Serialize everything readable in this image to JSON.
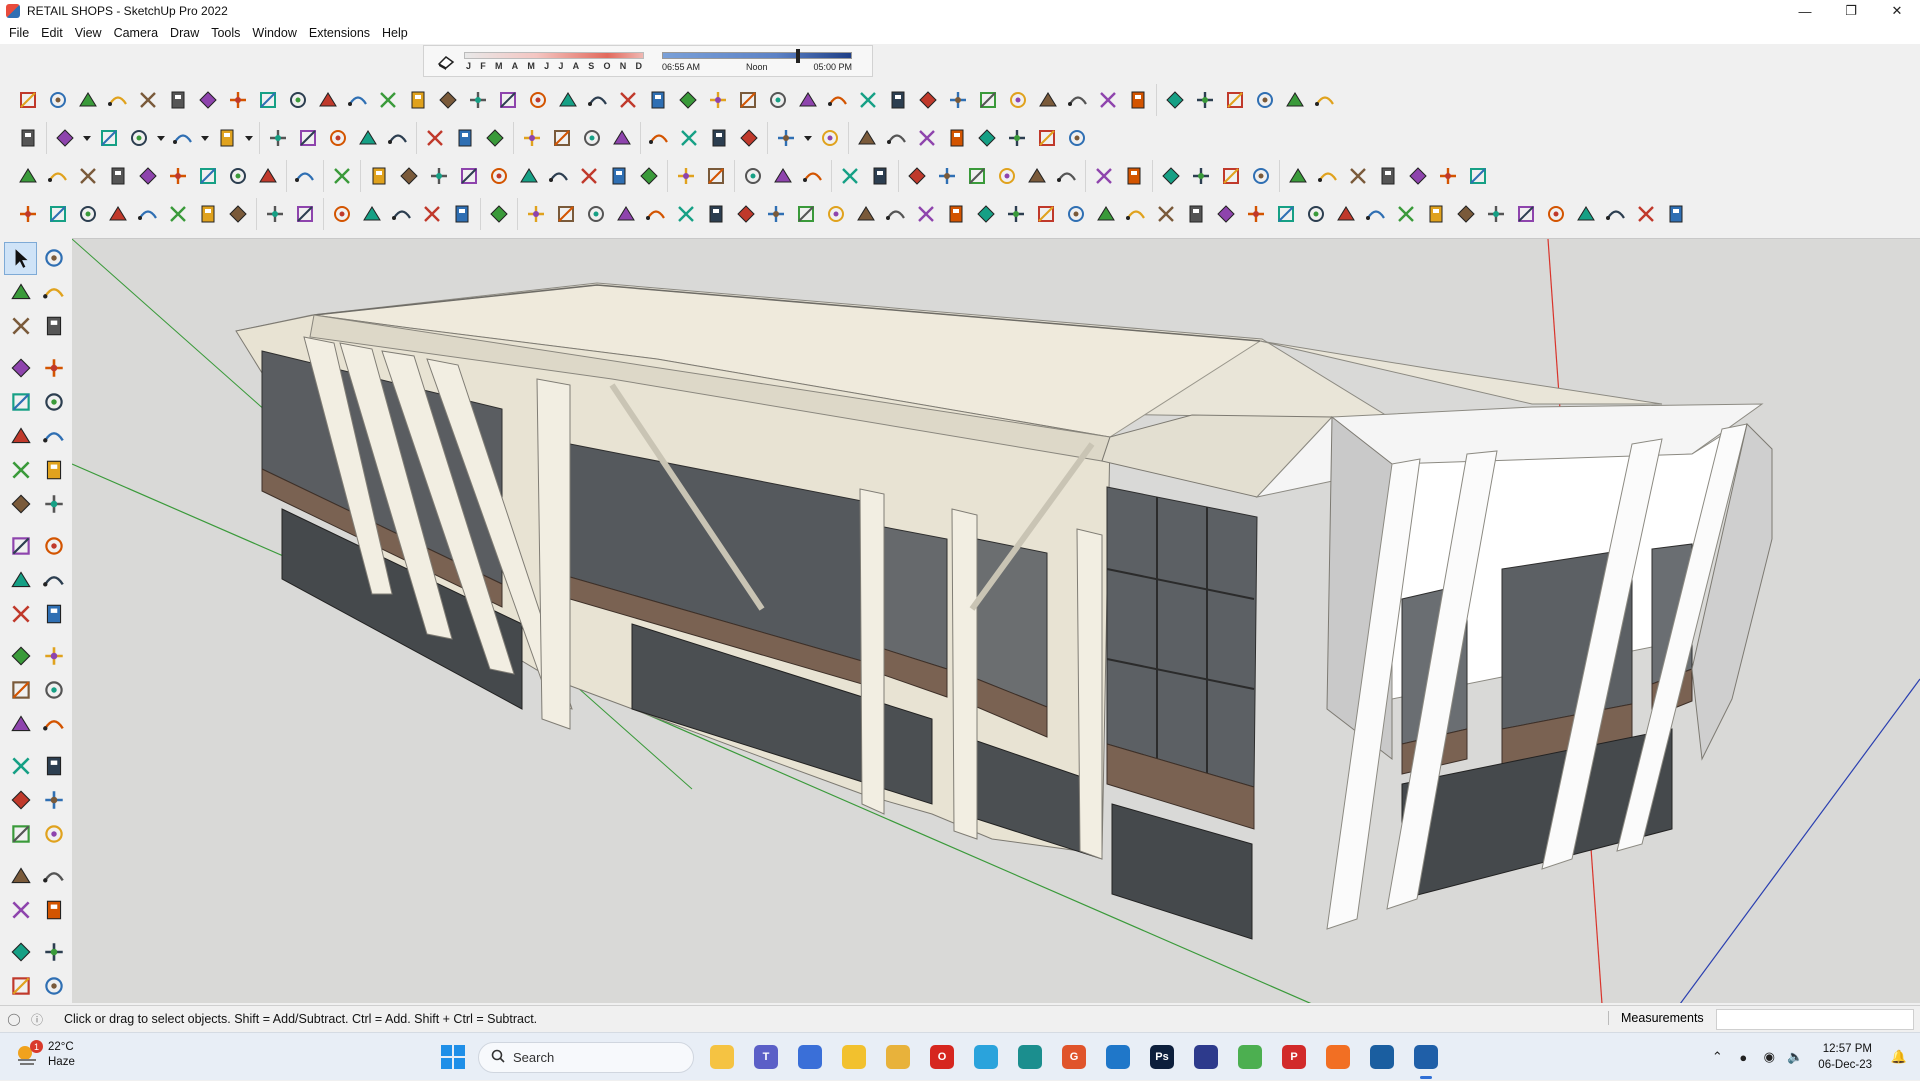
{
  "window": {
    "title": "RETAIL SHOPS - SketchUp Pro 2022",
    "controls": [
      "minimize",
      "maximize",
      "close"
    ]
  },
  "menubar": {
    "items": [
      "File",
      "Edit",
      "View",
      "Camera",
      "Draw",
      "Tools",
      "Window",
      "Extensions",
      "Help"
    ]
  },
  "shadows": {
    "months": [
      "J",
      "F",
      "M",
      "A",
      "M",
      "J",
      "J",
      "A",
      "S",
      "O",
      "N",
      "D"
    ],
    "time_start": "06:55 AM",
    "time_mid": "Noon",
    "time_end": "05:00 PM",
    "time_position": 0.72
  },
  "toolbars": {
    "row1_groups": [
      [
        "freehand-icon",
        "arc-icon",
        "follow-icon",
        "weld-icon",
        "shape-icon",
        "curve-icon",
        "loft-icon",
        "sphere-icon",
        "bezier-icon",
        "line-icon",
        "line2-icon",
        "divide-icon",
        "offset-icon",
        "window-icon",
        "stair-icon",
        "fence-icon",
        "grid-icon",
        "hand-icon",
        "leaf-icon",
        "tri-icon",
        "stack-icon",
        "slash-icon",
        "pipes-icon",
        "rail-icon",
        "pipe-icon",
        "wall-icon",
        "wall2-icon",
        "wedge-icon",
        "door-icon",
        "frame-icon",
        "hatch-icon",
        "columns-icon",
        "comb-icon",
        "gear-icon",
        "gear2-icon",
        "slab-icon",
        "star-icon",
        "shapes-icon"
      ],
      [
        "panel-icon",
        "cabinet-icon",
        "house-icon",
        "house2-icon",
        "home-icon",
        "garage-icon"
      ]
    ],
    "row2_groups": [
      [
        "zoom-window-icon"
      ],
      [
        "select-icon",
        "dropdown-icon",
        "eraser-icon",
        "pencil-icon",
        "dropdown-icon",
        "arc-tool-icon",
        "dropdown-icon",
        "rectangle-icon",
        "dropdown-icon"
      ],
      [
        "push-pull-icon",
        "follow-me-icon",
        "move-icon",
        "rotate-icon",
        "scale-icon"
      ],
      [
        "tape-icon",
        "text-icon",
        "paint-icon"
      ],
      [
        "orbit-icon",
        "pan-icon",
        "zoom-icon",
        "zoom-extents-icon"
      ],
      [
        "warehouse-icon",
        "extensions-icon",
        "layer-icon",
        "sandbox-icon"
      ],
      [
        "user-icon",
        "dropdown-icon",
        "arc-swipe-icon"
      ],
      [
        "axes-icon",
        "axes-x-icon",
        "axes-y-icon",
        "axes-z-icon",
        "axes-n-icon",
        "axes-e-icon",
        "axes-f-icon",
        "texture-icon"
      ]
    ],
    "row3_groups": [
      [
        "components-icon",
        "cube-icon",
        "box-icon",
        "xray-icon",
        "stripes-icon",
        "grid-view-icon",
        "wireframe-icon",
        "split-icon",
        "tree-icon"
      ],
      [
        "tag-icon"
      ],
      [
        "ruler-icon"
      ],
      [
        "square-outline-icon",
        "circle-outline-icon",
        "hex-outline-icon",
        "oval-outline-icon",
        "parallelogram-icon",
        "curve-outline-icon",
        "polygon-outline-icon",
        "star-outline-icon",
        "shape-outline-icon",
        "ring-icon"
      ],
      [
        "diagonal-icon",
        "eraser2-icon"
      ],
      [
        "section-plane-icon",
        "section-cut-icon",
        "section-fill-icon"
      ],
      [
        "terrain-icon",
        "terrain2-icon"
      ],
      [
        "style1-icon",
        "style2-icon",
        "style3-icon",
        "style4-icon",
        "style5-icon",
        "style6-icon"
      ],
      [
        "align-icon",
        "align2-icon"
      ],
      [
        "scene-icon",
        "scene2-icon",
        "scene3-icon",
        "lock-icon"
      ],
      [
        "roof-icon",
        "roof2-icon",
        "roof3-icon",
        "roof4-icon",
        "roof5-icon",
        "roof6-icon",
        "roof7-icon"
      ]
    ],
    "row4_groups": [
      [
        "solar-icon",
        "chair-icon",
        "target-icon",
        "protractor-icon",
        "tripod-icon",
        "sparkle-icon",
        "dome-icon",
        "sphere2-icon"
      ],
      [
        "solid-union-icon",
        "solid-subtract-icon"
      ],
      [
        "view-iso-icon",
        "view-top-icon",
        "view-front-icon",
        "view-right-icon",
        "view-back-icon"
      ],
      [
        "cursor-select-icon"
      ],
      [
        "blue-shape-icon",
        "blue-shape2-icon",
        "yellow-shape-icon",
        "green-shape-icon",
        "red-shape-icon",
        "grey-shape-icon",
        "orange-arc-icon",
        "red-frame-icon",
        "red-door-icon",
        "flag-icon",
        "box2-icon",
        "link-icon",
        "hook-icon",
        "nodes-icon",
        "red-cross-icon",
        "green-cross-icon",
        "blue-x-icon",
        "cone-icon",
        "mountain-icon",
        "yellow-tri-icon",
        "hook2-icon",
        "hook3-icon",
        "spiral-icon",
        "blue-move-icon",
        "bucket-icon",
        "magnet-icon",
        "tree2-icon",
        "puzzle-icon",
        "puzzle2-icon",
        "puzzle3-icon",
        "hex2-icon",
        "grid2-icon",
        "grid3-icon",
        "grid4-icon",
        "grid5-icon",
        "grid6-icon",
        "x-mark-icon",
        "lasso-icon",
        "split2-icon"
      ]
    ]
  },
  "left_toolbar": {
    "rows": [
      [
        "select-icon",
        "orbit-swoop-icon"
      ],
      [
        "paint-bucket-icon",
        "eraser-icon"
      ],
      [
        "component-icon",
        "tag-pencil-icon"
      ],
      [
        "pencil-icon",
        "freehand-icon"
      ],
      [
        "rectangle-icon",
        "rotated-rect-icon"
      ],
      [
        "circle-icon",
        "polygon-icon"
      ],
      [
        "arc-icon",
        "two-point-arc-icon"
      ],
      [
        "three-point-arc-icon",
        "pie-icon"
      ],
      [
        "move-icon",
        "push-pull-icon"
      ],
      [
        "rotate-icon",
        "follow-me-icon"
      ],
      [
        "scale-icon",
        "offset-icon"
      ],
      [
        "tape-measure-icon",
        "dimension-icon"
      ],
      [
        "protractor-icon",
        "text-icon"
      ],
      [
        "axes-icon",
        "3d-text-icon"
      ],
      [
        "orbit-icon",
        "pan-icon"
      ],
      [
        "zoom-icon",
        "zoom-window-icon"
      ],
      [
        "zoom-extents-icon",
        "previous-icon"
      ],
      [
        "position-camera-icon",
        "look-around-icon"
      ],
      [
        "walk-icon",
        "section-plane-icon"
      ],
      [
        "warehouse-icon",
        "extension-warehouse-icon"
      ],
      [
        "layout-icon",
        "extension-manager-icon"
      ]
    ]
  },
  "status": {
    "hint": "Click or drag to select objects. Shift = Add/Subtract. Ctrl = Add. Shift + Ctrl = Subtract.",
    "measurements_label": "Measurements",
    "measurements_value": ""
  },
  "taskbar": {
    "weather_temp": "22°C",
    "weather_desc": "Haze",
    "weather_badge": "1",
    "search_label": "Search",
    "apps": [
      {
        "name": "file-explorer",
        "color": "#f5c342",
        "glyph": ""
      },
      {
        "name": "teams",
        "color": "#5b5fc7",
        "glyph": "T"
      },
      {
        "name": "calculator",
        "color": "#3a6fd8",
        "glyph": ""
      },
      {
        "name": "sticky-notes",
        "color": "#f2c12e",
        "glyph": ""
      },
      {
        "name": "folder",
        "color": "#e8b23b",
        "glyph": ""
      },
      {
        "name": "opera",
        "color": "#d6261f",
        "glyph": "O"
      },
      {
        "name": "telegram",
        "color": "#2aa3dc",
        "glyph": ""
      },
      {
        "name": "teal-app",
        "color": "#1b8e8e",
        "glyph": ""
      },
      {
        "name": "g-app",
        "color": "#e0542b",
        "glyph": "G"
      },
      {
        "name": "vscode",
        "color": "#1f77c9",
        "glyph": ""
      },
      {
        "name": "photoshop",
        "color": "#0d1f3c",
        "glyph": "Ps"
      },
      {
        "name": "triangle-app",
        "color": "#2d3a8c",
        "glyph": ""
      },
      {
        "name": "chrome",
        "color": "#4caf50",
        "glyph": ""
      },
      {
        "name": "pinterest",
        "color": "#d22a2a",
        "glyph": "P"
      },
      {
        "name": "soundcloud",
        "color": "#f26f23",
        "glyph": ""
      },
      {
        "name": "sketchup-app",
        "color": "#1a5ea0",
        "glyph": ""
      },
      {
        "name": "sketchup-active",
        "color": "#1f5fa8",
        "glyph": ""
      }
    ],
    "clock_time": "12:57 PM",
    "clock_date": "06-Dec-23"
  },
  "colors": {
    "viewport_bg": "#d9d9d7",
    "facade": "#ebe6d6",
    "glass": "#565a5e",
    "trim": "#7a6252",
    "axis_red": "#d9342b",
    "axis_green": "#3a9a3a",
    "axis_blue": "#2a3fb0"
  }
}
